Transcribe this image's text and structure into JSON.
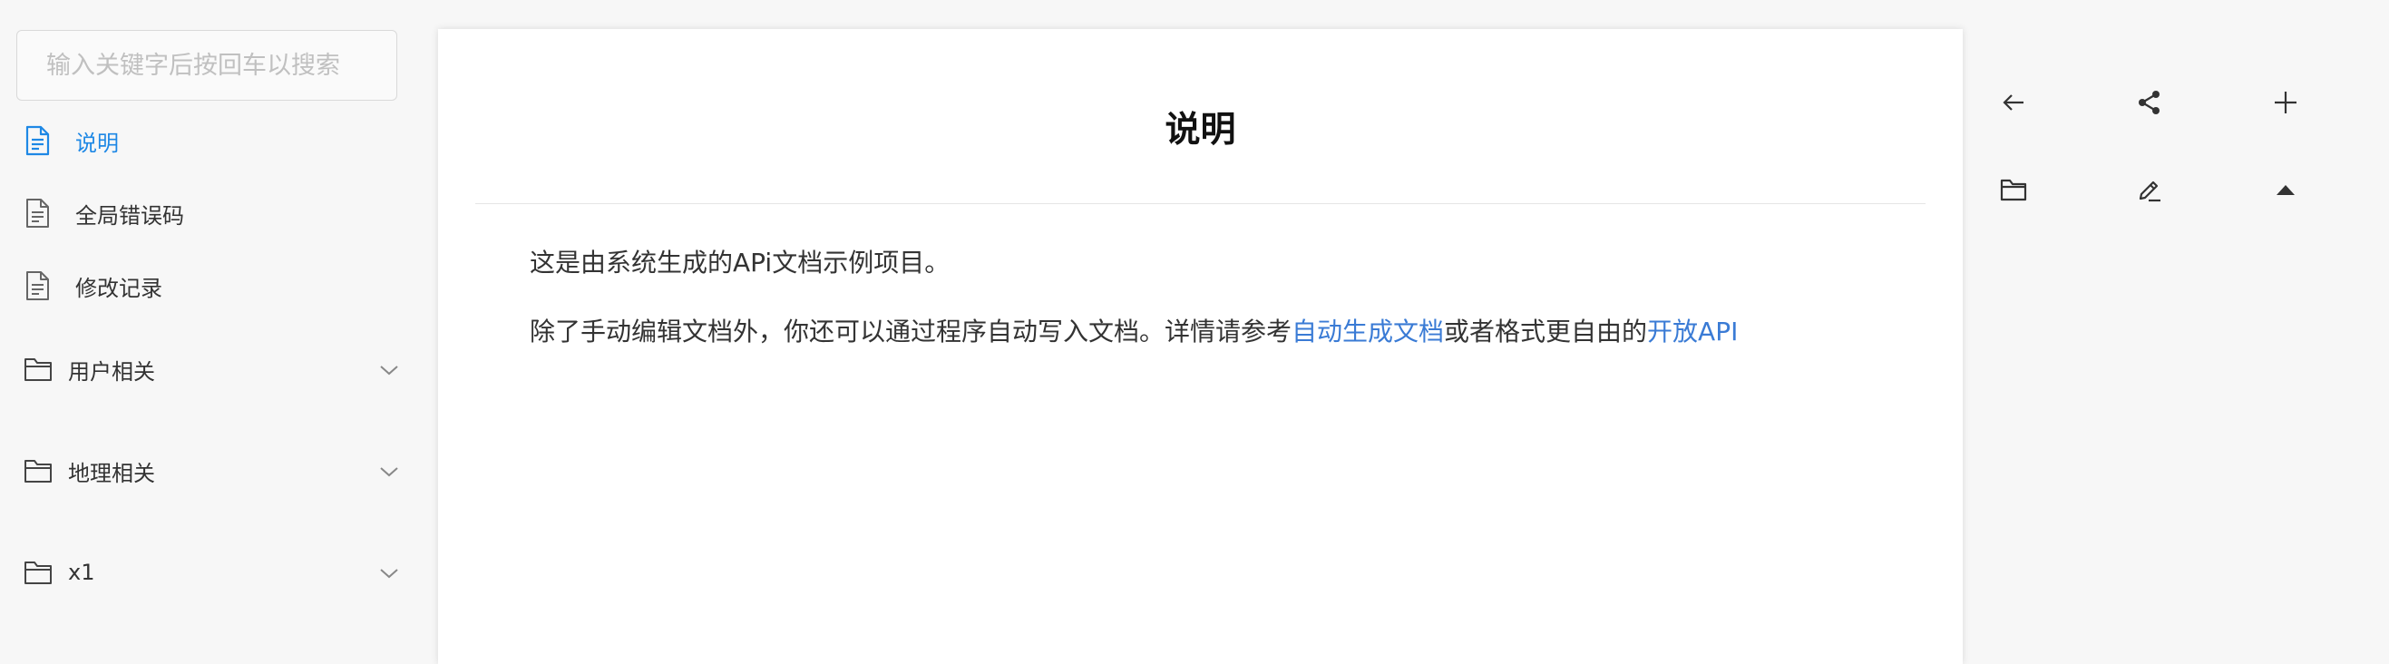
{
  "sidebar": {
    "search": {
      "placeholder": "输入关键字后按回车以搜索",
      "value": ""
    },
    "pages": [
      {
        "label": "说明",
        "icon": "document-icon",
        "active": true
      },
      {
        "label": "全局错误码",
        "icon": "document-icon",
        "active": false
      },
      {
        "label": "修改记录",
        "icon": "document-icon",
        "active": false
      }
    ],
    "folders": [
      {
        "label": "用户相关",
        "icon": "folder-icon",
        "expanded": false
      },
      {
        "label": "地理相关",
        "icon": "folder-icon",
        "expanded": false
      },
      {
        "label": "x1",
        "icon": "folder-icon",
        "expanded": false
      }
    ]
  },
  "doc": {
    "title": "说明",
    "para1": "这是由系统生成的APi文档示例项目。",
    "para2_prefix": "除了手动编辑文档外，你还可以通过程序自动写入文档。详情请参考",
    "link1": "自动生成文档",
    "para2_mid": "或者格式更自由的",
    "link2": "开放API"
  },
  "toolbar": [
    {
      "name": "back-arrow-icon"
    },
    {
      "name": "share-icon"
    },
    {
      "name": "plus-icon"
    },
    {
      "name": "folder-icon"
    },
    {
      "name": "edit-icon"
    },
    {
      "name": "caret-up-icon"
    }
  ],
  "colors": {
    "accent": "#1e88e5",
    "link": "#3a7bd5",
    "text": "#333333",
    "page_bg": "#f7f7f7",
    "panel_bg": "#ffffff"
  }
}
